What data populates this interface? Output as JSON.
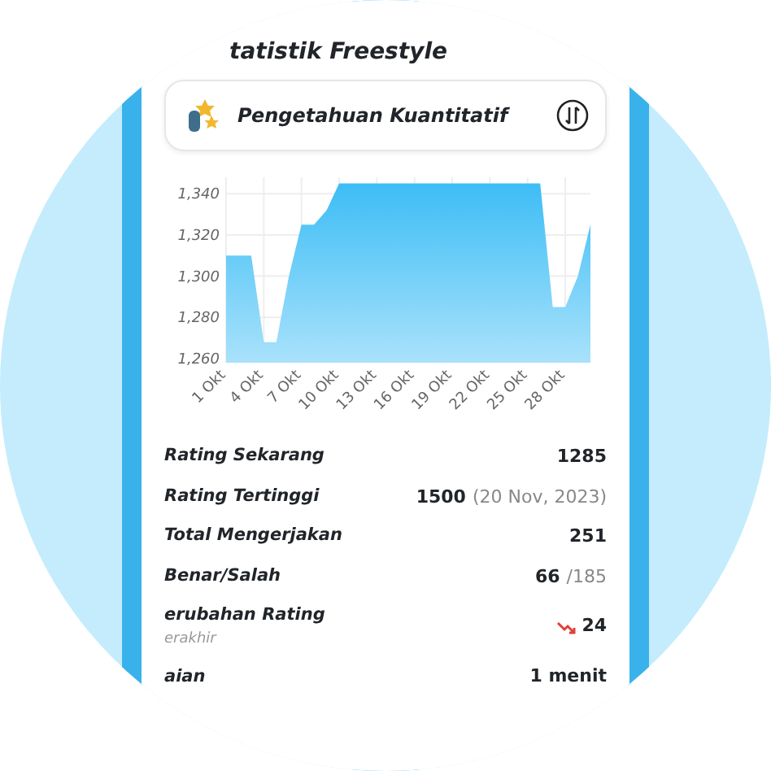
{
  "page_title": "tatistik Freestyle",
  "subject": {
    "name": "Pengetahuan Kuantitatif"
  },
  "chart_data": {
    "type": "area",
    "x": [
      1,
      2,
      3,
      4,
      5,
      6,
      7,
      8,
      9,
      10,
      11,
      12,
      13,
      14,
      15,
      16,
      17,
      18,
      19,
      20,
      21,
      22,
      23,
      24,
      25,
      26,
      27,
      28,
      29,
      30
    ],
    "grid": true,
    "series": [
      {
        "color": "#3dbdf5",
        "values": [
          1310,
          1310,
          1310,
          1268,
          1268,
          1300,
          1325,
          1325,
          1332,
          1345,
          1345,
          1345,
          1345,
          1345,
          1345,
          1345,
          1345,
          1345,
          1345,
          1345,
          1345,
          1345,
          1345,
          1345,
          1345,
          1345,
          1285,
          1285,
          1300,
          1325
        ]
      }
    ],
    "xlim": [
      1,
      30
    ],
    "ylim": [
      1258,
      1348
    ],
    "yticks": [
      {
        "value": 1260,
        "label": "1,260"
      },
      {
        "value": 1280,
        "label": "1,280"
      },
      {
        "value": 1300,
        "label": "1,300"
      },
      {
        "value": 1320,
        "label": "1,320"
      },
      {
        "value": 1340,
        "label": "1,340"
      }
    ],
    "xticks": [
      {
        "value": 1,
        "label": "1 Okt"
      },
      {
        "value": 4,
        "label": "4 Okt"
      },
      {
        "value": 7,
        "label": "7 Okt"
      },
      {
        "value": 10,
        "label": "10 Okt"
      },
      {
        "value": 13,
        "label": "13 Okt"
      },
      {
        "value": 16,
        "label": "16 Okt"
      },
      {
        "value": 19,
        "label": "19 Okt"
      },
      {
        "value": 22,
        "label": "22 Okt"
      },
      {
        "value": 25,
        "label": "25 Okt"
      },
      {
        "value": 28,
        "label": "28 Okt"
      }
    ]
  },
  "stats": [
    {
      "label": "Rating Sekarang",
      "value": "1285"
    },
    {
      "label": "Rating Tertinggi",
      "value": "1500",
      "note": "(20 Nov, 2023)"
    },
    {
      "label": "Total Mengerjakan",
      "value": "251"
    },
    {
      "label": "Benar/Salah",
      "value": "66",
      "total": "/185"
    },
    {
      "label": "erubahan Rating",
      "sublabel": "erakhir",
      "value": "24",
      "falling": true
    },
    {
      "label": "aian",
      "value": "1 menit"
    }
  ]
}
